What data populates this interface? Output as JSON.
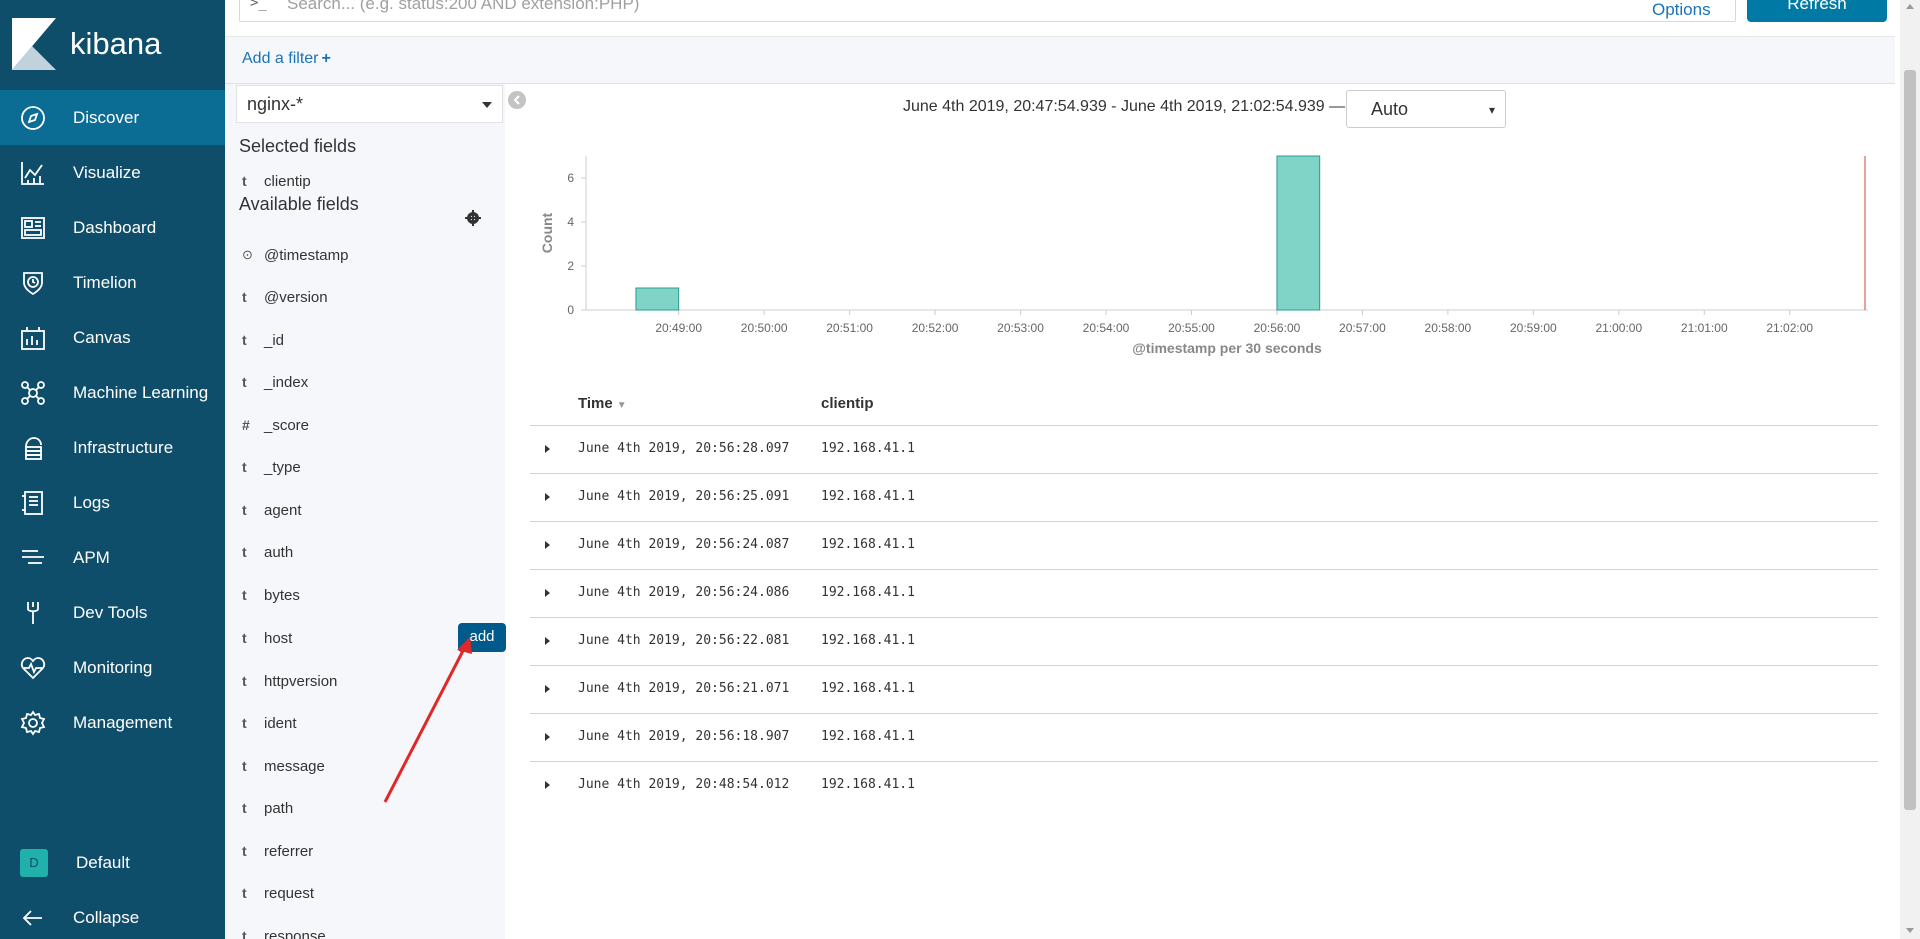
{
  "app": {
    "brand": "kibana"
  },
  "nav": {
    "items": [
      {
        "label": "Discover",
        "icon": "compass-icon",
        "active": true
      },
      {
        "label": "Visualize",
        "icon": "chart-icon"
      },
      {
        "label": "Dashboard",
        "icon": "dashboard-icon"
      },
      {
        "label": "Timelion",
        "icon": "shield-icon"
      },
      {
        "label": "Canvas",
        "icon": "canvas-icon"
      },
      {
        "label": "Machine Learning",
        "icon": "ml-icon"
      },
      {
        "label": "Infrastructure",
        "icon": "infrastructure-icon"
      },
      {
        "label": "Logs",
        "icon": "logs-icon"
      },
      {
        "label": "APM",
        "icon": "apm-icon"
      },
      {
        "label": "Dev Tools",
        "icon": "wrench-icon"
      },
      {
        "label": "Monitoring",
        "icon": "heartbeat-icon"
      },
      {
        "label": "Management",
        "icon": "gear-icon"
      }
    ],
    "space": {
      "initial": "D",
      "label": "Default"
    },
    "collapse": "Collapse"
  },
  "query": {
    "prompt": ">_",
    "placeholder": "Search... (e.g. status:200 AND extension:PHP)",
    "options": "Options",
    "refresh": "Refresh"
  },
  "filter": {
    "add": "Add a filter",
    "plus": "+"
  },
  "sidebar": {
    "index_pattern": "nginx-*",
    "selected_heading": "Selected fields",
    "selected": [
      {
        "type": "t",
        "name": "clientip"
      }
    ],
    "available_heading": "Available fields",
    "available": [
      {
        "type": "⊙",
        "name": "@timestamp"
      },
      {
        "type": "t",
        "name": "@version"
      },
      {
        "type": "t",
        "name": "_id"
      },
      {
        "type": "t",
        "name": "_index"
      },
      {
        "type": "#",
        "name": "_score"
      },
      {
        "type": "t",
        "name": "_type"
      },
      {
        "type": "t",
        "name": "agent"
      },
      {
        "type": "t",
        "name": "auth"
      },
      {
        "type": "t",
        "name": "bytes"
      },
      {
        "type": "t",
        "name": "host"
      },
      {
        "type": "t",
        "name": "httpversion"
      },
      {
        "type": "t",
        "name": "ident"
      },
      {
        "type": "t",
        "name": "message"
      },
      {
        "type": "t",
        "name": "path"
      },
      {
        "type": "t",
        "name": "referrer"
      },
      {
        "type": "t",
        "name": "request"
      },
      {
        "type": "t",
        "name": "response"
      }
    ],
    "add_button": "add"
  },
  "main": {
    "time_range": "June 4th 2019, 20:47:54.939 - June 4th 2019, 21:02:54.939 —",
    "interval": "Auto"
  },
  "chart_data": {
    "type": "bar",
    "x": [
      "20:48:30",
      "20:56:00"
    ],
    "values": [
      1,
      7
    ],
    "categories": [
      "20:49:00",
      "20:50:00",
      "20:51:00",
      "20:52:00",
      "20:53:00",
      "20:54:00",
      "20:55:00",
      "20:56:00",
      "20:57:00",
      "20:58:00",
      "20:59:00",
      "21:00:00",
      "21:01:00",
      "21:02:00"
    ],
    "yticks": [
      "0",
      "2",
      "4",
      "6"
    ],
    "ylim": [
      0,
      7
    ],
    "ylabel": "Count",
    "xlabel": "@timestamp per 30 seconds",
    "bar_color": "#7fd3c7"
  },
  "table": {
    "columns": [
      "Time",
      "clientip"
    ],
    "rows": [
      {
        "time": "June 4th 2019, 20:56:28.097",
        "clientip": "192.168.41.1"
      },
      {
        "time": "June 4th 2019, 20:56:25.091",
        "clientip": "192.168.41.1"
      },
      {
        "time": "June 4th 2019, 20:56:24.087",
        "clientip": "192.168.41.1"
      },
      {
        "time": "June 4th 2019, 20:56:24.086",
        "clientip": "192.168.41.1"
      },
      {
        "time": "June 4th 2019, 20:56:22.081",
        "clientip": "192.168.41.1"
      },
      {
        "time": "June 4th 2019, 20:56:21.071",
        "clientip": "192.168.41.1"
      },
      {
        "time": "June 4th 2019, 20:56:18.907",
        "clientip": "192.168.41.1"
      },
      {
        "time": "June 4th 2019, 20:48:54.012",
        "clientip": "192.168.41.1"
      }
    ]
  }
}
